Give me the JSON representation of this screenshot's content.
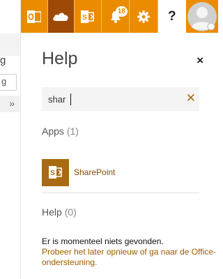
{
  "left_pane": {
    "fragment": "g",
    "chevron": "»"
  },
  "topbar": {
    "accent": "#eb8c00",
    "active_bg": "#9e4a06",
    "icons": [
      "outlook-icon",
      "onedrive-icon",
      "sharepoint-icon",
      "bell-icon",
      "gear-icon",
      "help-icon",
      "avatar"
    ],
    "notification_count": "18",
    "help_glyph": "?"
  },
  "panel": {
    "title": "Help",
    "close_glyph": "×",
    "search": {
      "value": "shar",
      "clear_glyph": "✕"
    },
    "apps": {
      "label": "Apps",
      "count": "(1)",
      "items": [
        {
          "name": "SharePoint",
          "icon": "sharepoint-icon"
        }
      ]
    },
    "help": {
      "label": "Help",
      "count": "(0)",
      "empty_message": "Er is momenteel niets gevonden.",
      "link_text": "Probeer het later opnieuw of ga naar de Office-ondersteuning."
    }
  }
}
